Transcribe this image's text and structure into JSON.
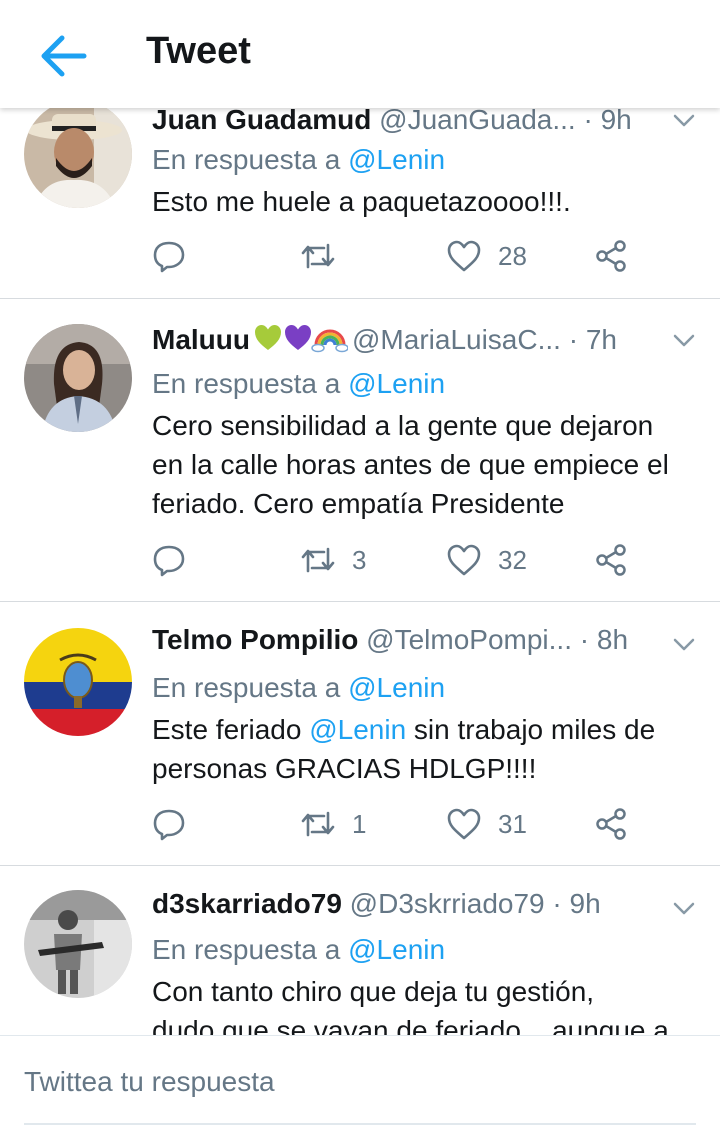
{
  "header": {
    "title": "Tweet"
  },
  "tweets": [
    {
      "name": "Juan Guadamud",
      "handle": "@JuanGuada...",
      "time": "· 9h",
      "reply_prefix": "En respuesta a ",
      "reply_to": "@Lenin",
      "text": "Esto me huele a paquetazoooo!!!.",
      "retweets": "",
      "likes": "28"
    },
    {
      "name": "Maluuu",
      "handle": "@MariaLuisaC...",
      "time": "· 7h",
      "reply_prefix": "En respuesta a ",
      "reply_to": "@Lenin",
      "text_lines": [
        "Cero sensibilidad a la gente que dejaron",
        "en la calle horas antes de que empiece el",
        "feriado. Cero empatía Presidente"
      ],
      "retweets": "3",
      "likes": "32"
    },
    {
      "name": "Telmo Pompilio",
      "handle": "@TelmoPompi...",
      "time": "· 8h",
      "reply_prefix": "En respuesta a ",
      "reply_to": "@Lenin",
      "text_part1": "Este feriado ",
      "text_mention": "@Lenin",
      "text_part2": " sin trabajo miles de",
      "text_line2": "personas GRACIAS HDLGP!!!!",
      "retweets": "1",
      "likes": "31"
    },
    {
      "name": "d3skarriado79",
      "handle": "@D3skrriado79",
      "time": "· 9h",
      "reply_prefix": "En respuesta a ",
      "reply_to": "@Lenin",
      "text_lines": [
        "Con tanto chiro que deja tu gestión,",
        "dudo que se vayan de feriado... aunque a"
      ]
    }
  ],
  "compose": {
    "placeholder": "Twittea tu respuesta"
  },
  "colors": {
    "accent": "#1da1f2",
    "muted": "#657786",
    "text": "#14171a"
  },
  "icons": [
    "back-arrow-icon",
    "chevron-down-icon",
    "reply-icon",
    "retweet-icon",
    "like-icon",
    "share-icon"
  ]
}
